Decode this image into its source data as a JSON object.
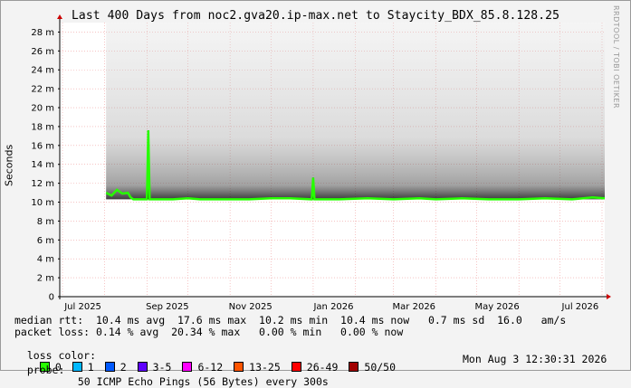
{
  "title": "Last 400 Days from noc2.gva20.ip-max.net to Staycity_BDX_85.8.128.25",
  "side_label": "RRDTOOL / TOBI OETIKER",
  "stats": {
    "median_line": "median rtt:  10.4 ms avg  17.6 ms max  10.2 ms min  10.4 ms now   0.7 ms sd  16.0   am/s",
    "loss_line": "packet loss: 0.14 % avg  20.34 % max   0.00 % min   0.00 % now",
    "loss_color_label": "loss color:",
    "probe_label": "probe:",
    "probe_text": "50 ICMP Echo Pings (56 Bytes) every 300s",
    "date": "Mon Aug  3 12:30:31 2026"
  },
  "loss_colors": [
    {
      "label": "0",
      "color": "#26ff00"
    },
    {
      "label": "1",
      "color": "#00b8ff"
    },
    {
      "label": "2",
      "color": "#0059ff"
    },
    {
      "label": "3-5",
      "color": "#5e00ff"
    },
    {
      "label": "6-12",
      "color": "#ff00ff"
    },
    {
      "label": "13-25",
      "color": "#ff5500"
    },
    {
      "label": "26-49",
      "color": "#ff0000"
    },
    {
      "label": "50/50",
      "color": "#a10000"
    }
  ],
  "chart_data": {
    "type": "line",
    "title": "Last 400 Days from noc2.gva20.ip-max.net to Staycity_BDX_85.8.128.25",
    "xlabel": "",
    "ylabel": "Seconds",
    "y_unit_suffix": "m",
    "ylim": [
      0,
      0.029
    ],
    "yticks": [
      0,
      2,
      4,
      6,
      8,
      10,
      12,
      14,
      16,
      18,
      20,
      22,
      24,
      26,
      28
    ],
    "x_ticks": [
      "Jul 2025",
      "Sep 2025",
      "Nov 2025",
      "Jan 2026",
      "Mar 2026",
      "May 2026",
      "Jul 2026"
    ],
    "xlim": [
      "2025-06-29",
      "2026-08-03"
    ],
    "data_start": "2025-08-02",
    "grid": true,
    "series": [
      {
        "name": "median rtt",
        "x": [
          "2025-08-02",
          "2025-08-06",
          "2025-08-10",
          "2025-08-14",
          "2025-08-18",
          "2025-08-20",
          "2025-08-22",
          "2025-09-01",
          "2025-09-02",
          "2025-09-03",
          "2025-09-20",
          "2025-10-01",
          "2025-10-10",
          "2025-11-01",
          "2025-11-15",
          "2025-12-01",
          "2025-12-15",
          "2025-12-31",
          "2026-01-01",
          "2026-01-02",
          "2026-01-20",
          "2026-02-10",
          "2026-03-01",
          "2026-03-20",
          "2026-04-01",
          "2026-04-20",
          "2026-05-10",
          "2026-06-01",
          "2026-06-20",
          "2026-07-10",
          "2026-07-25",
          "2026-08-03"
        ],
        "values": [
          11.0,
          10.7,
          11.3,
          10.9,
          11.0,
          10.5,
          10.3,
          10.3,
          17.6,
          10.3,
          10.3,
          10.4,
          10.3,
          10.3,
          10.3,
          10.4,
          10.4,
          10.3,
          12.6,
          10.3,
          10.3,
          10.4,
          10.3,
          10.4,
          10.3,
          10.4,
          10.3,
          10.3,
          10.4,
          10.3,
          10.5,
          10.4
        ]
      }
    ]
  }
}
